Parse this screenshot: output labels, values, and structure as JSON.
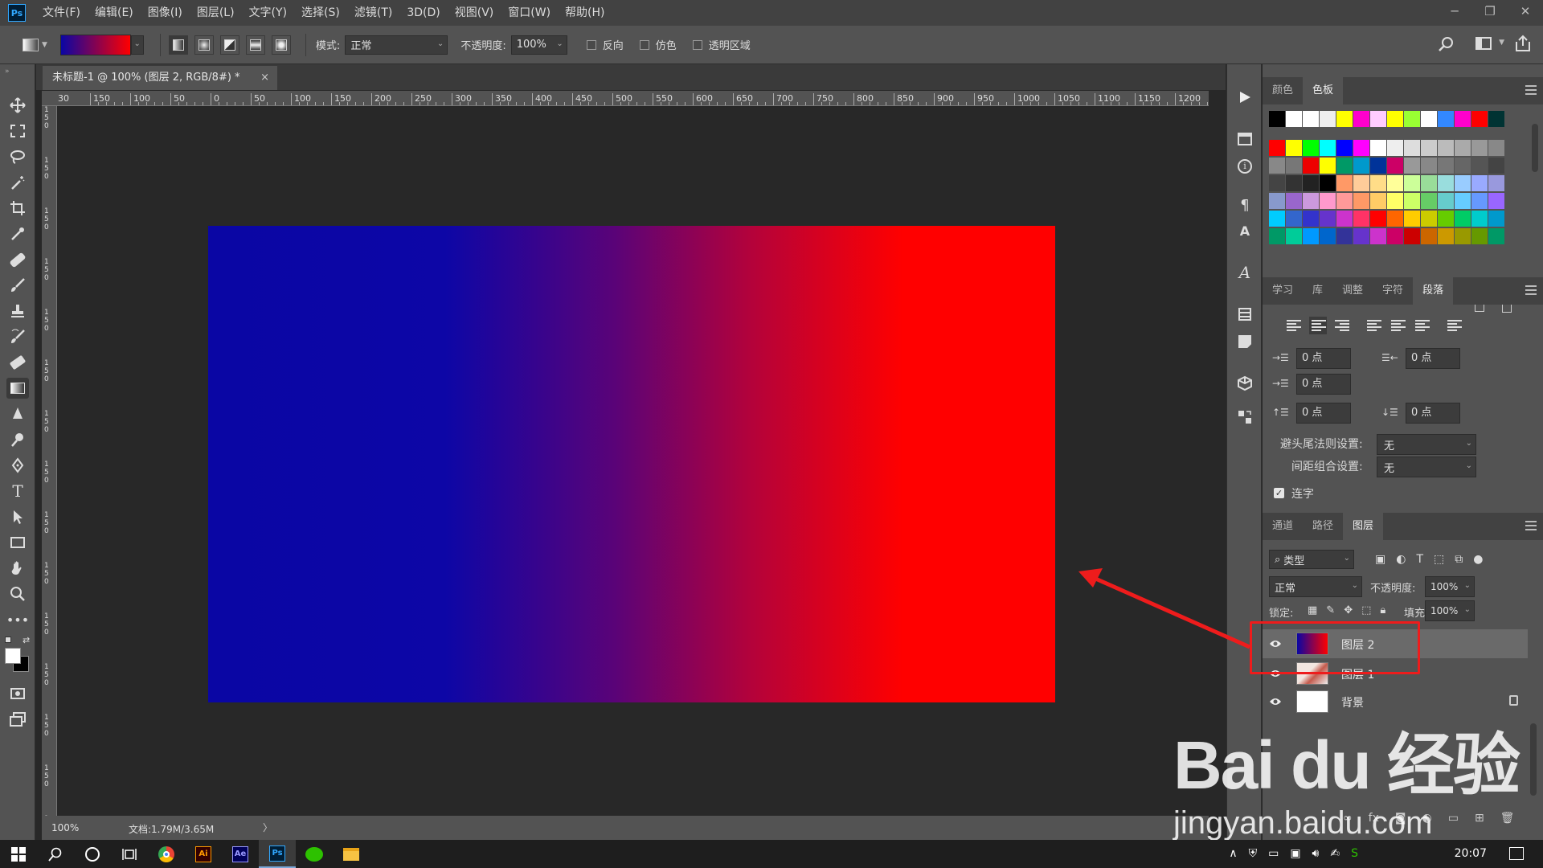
{
  "app": {
    "logo": "Ps"
  },
  "menu": [
    "文件(F)",
    "编辑(E)",
    "图像(I)",
    "图层(L)",
    "文字(Y)",
    "选择(S)",
    "滤镜(T)",
    "3D(D)",
    "视图(V)",
    "窗口(W)",
    "帮助(H)"
  ],
  "options": {
    "mode_label": "模式:",
    "mode_value": "正常",
    "opacity_label": "不透明度:",
    "opacity_value": "100%",
    "reverse": "反向",
    "dither": "仿色",
    "transparency": "透明区域",
    "gradient_colors": [
      "#0a06a4",
      "#ff0000"
    ]
  },
  "document": {
    "tab_title": "未标题-1 @ 100% (图层 2, RGB/8#) *",
    "close": "×",
    "zoom": "100%",
    "doc_info": "文档:1.79M/3.65M",
    "ruler_h": [
      "1",
      "50",
      "100",
      "50",
      "0",
      "50",
      "100",
      "150",
      "200",
      "250",
      "300",
      "350",
      "400",
      "450",
      "500",
      "550",
      "600",
      "650",
      "700",
      "750",
      "800",
      "850",
      "900",
      "950",
      "1000",
      "1050",
      "1100",
      "1150",
      "1200"
    ],
    "ruler_h_first": "30",
    "canvas_colors": [
      "#0a06a4",
      "#ff0000"
    ]
  },
  "swatch_panel": {
    "tabs": [
      "颜色",
      "色板"
    ]
  },
  "paragraph_panel": {
    "tabs": [
      "学习",
      "库",
      "调整",
      "字符",
      "段落"
    ],
    "indent_left": "0 点",
    "indent_right": "0 点",
    "indent_first": "0 点",
    "space_before": "0 点",
    "space_after": "0 点",
    "kinsoku_label": "避头尾法则设置:",
    "kinsoku_value": "无",
    "mojikumi_label": "间距组合设置:",
    "mojikumi_value": "无",
    "hyphenate": "连字"
  },
  "layers_panel": {
    "tabs": [
      "通道",
      "路径",
      "图层"
    ],
    "filter": "类型",
    "blend": "正常",
    "opacity_label": "不透明度:",
    "opacity_value": "100%",
    "lock_label": "锁定:",
    "fill_label": "填充:",
    "fill_value": "100%",
    "layers": [
      {
        "name": "图层 2",
        "selected": true
      },
      {
        "name": "图层 1",
        "selected": false
      },
      {
        "name": "背景",
        "selected": false,
        "locked": true
      }
    ]
  },
  "taskbar": {
    "clock": "20:07"
  },
  "watermark": {
    "line1": "Bai du 经验",
    "line2": "jingyan.baidu.com"
  }
}
